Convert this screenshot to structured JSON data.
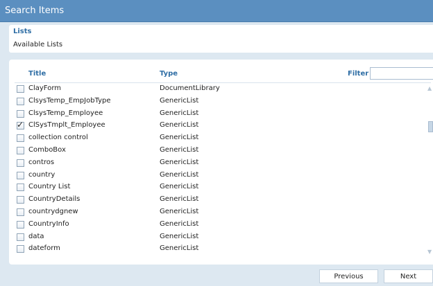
{
  "dialog": {
    "title": "Search Items"
  },
  "lists_section": {
    "heading": "Lists",
    "subheading": "Available Lists"
  },
  "table": {
    "col_title": "Title",
    "col_type": "Type",
    "filter_label": "Filter",
    "filter_value": "",
    "rows": [
      {
        "title": "ClayForm",
        "type": "DocumentLibrary",
        "checked": false
      },
      {
        "title": "ClsysTemp_EmpJobType",
        "type": "GenericList",
        "checked": false
      },
      {
        "title": "ClsysTemp_Employee",
        "type": "GenericList",
        "checked": false
      },
      {
        "title": "ClSysTmplt_Employee",
        "type": "GenericList",
        "checked": true
      },
      {
        "title": "collection control",
        "type": "GenericList",
        "checked": false
      },
      {
        "title": "ComboBox",
        "type": "GenericList",
        "checked": false
      },
      {
        "title": "contros",
        "type": "GenericList",
        "checked": false
      },
      {
        "title": "country",
        "type": "GenericList",
        "checked": false
      },
      {
        "title": "Country List",
        "type": "GenericList",
        "checked": false
      },
      {
        "title": "CountryDetails",
        "type": "GenericList",
        "checked": false
      },
      {
        "title": "countrydgnew",
        "type": "GenericList",
        "checked": false
      },
      {
        "title": "CountryInfo",
        "type": "GenericList",
        "checked": false
      },
      {
        "title": "data",
        "type": "GenericList",
        "checked": false
      },
      {
        "title": "dateform",
        "type": "GenericList",
        "checked": false
      }
    ]
  },
  "pager": {
    "previous_label": "Previous",
    "next_label": "Next"
  },
  "icons": {
    "check": "checkmark-icon",
    "scroll_up": "scroll-up-arrow-icon",
    "scroll_down": "scroll-down-arrow-icon"
  },
  "colors": {
    "titlebar": "#5b8fc0",
    "heading_text": "#2f6ea5",
    "background": "#dde8f1"
  }
}
